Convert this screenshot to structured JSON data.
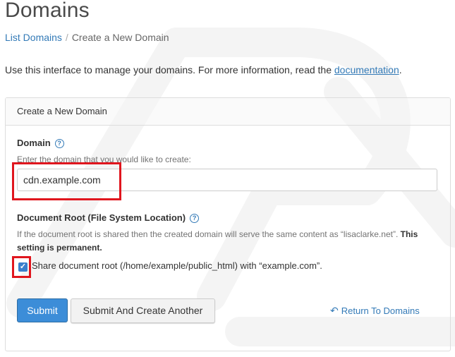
{
  "page_title": "Domains",
  "breadcrumb": {
    "link": "List Domains",
    "current": "Create a New Domain"
  },
  "intro": {
    "text": "Use this interface to manage your domains. For more information, read the ",
    "link": "documentation",
    "end": "."
  },
  "panel": {
    "title": "Create a New Domain",
    "domain": {
      "label": "Domain",
      "hint": "Enter the domain that you would like to create:",
      "value": "cdn.example.com"
    },
    "docroot": {
      "label": "Document Root (File System Location)",
      "description": "If the document root is shared then the created domain will serve the same content as “lisaclarke.net”.",
      "permanent": "This setting is permanent.",
      "checkbox_label": "Share document root (/home/example/public_html) with “example.com”.",
      "checked": true
    },
    "buttons": {
      "submit": "Submit",
      "submit_another": "Submit And Create Another",
      "return": "Return To Domains"
    }
  },
  "colors": {
    "accent": "#337ab7",
    "primary_button": "#3c8dd8",
    "highlight": "#e0161e"
  },
  "icons": [
    "help-icon",
    "check-icon",
    "return-arrow-icon"
  ]
}
